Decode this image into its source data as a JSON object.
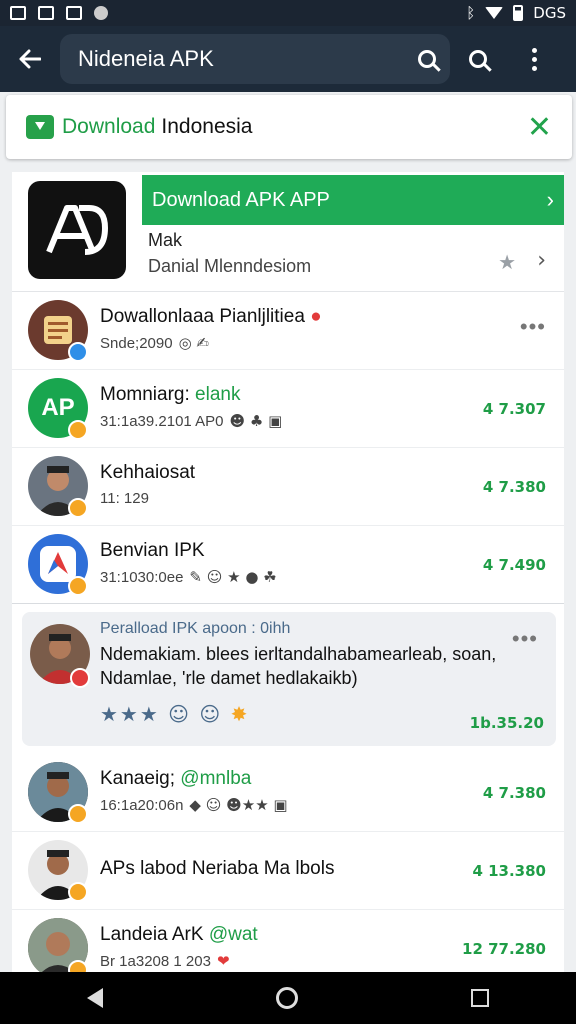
{
  "status": {
    "time": "DGS"
  },
  "appbar": {
    "search_query": "Nideneia APK"
  },
  "banner": {
    "title_green": "Download",
    "title_dark": "Indonesia"
  },
  "featured": {
    "logo_text": "A",
    "button_label": "Download APK APP",
    "line1": "Mak",
    "line2": "Danial Mlenndesiom"
  },
  "list": [
    {
      "title": "Dowallonlaaa Pianljlitiea",
      "meta": "Snde;2090",
      "score": "",
      "avatar_color": "#6b3a2e",
      "badge": "blue"
    },
    {
      "title": "Momniarg:",
      "title_accent": "elank",
      "meta": "31:1a39.2101 AP0",
      "score": "4 7.307",
      "avatar_color": "#19a64f",
      "avatar_text": "AP",
      "badge": "orange"
    },
    {
      "title": "Kehhaiosat",
      "meta": "11: 129",
      "score": "4 7.380",
      "avatar_color": "#6a7480",
      "badge": "orange"
    },
    {
      "title": "Benvian IPK",
      "meta": "31:1030:0ee",
      "score": "4 7.490",
      "avatar_color": "#2f6fd8",
      "badge": "orange"
    }
  ],
  "highlight": {
    "head": "Peralload IPK apoon : 0ihh",
    "text1": "Ndemakiam. blees ierltandalhabamearleab, soan,",
    "text2": "Ndamlae, 'rle damet hedlakaikb)",
    "reactions": "★★★ ☺ ☺",
    "score": "1b.35.20"
  },
  "list2": [
    {
      "title": "Kanaeig;",
      "title_accent": "@mnlba",
      "meta": "16:1a20:06n",
      "score": "4 7.380",
      "avatar_color": "#3a2a22",
      "badge": "orange"
    },
    {
      "title": "APs labod Neriaba Ma lbols",
      "meta": "",
      "score": "4 13.380",
      "avatar_color": "#3b2a22",
      "badge": "orange"
    },
    {
      "title": "Landeia ArK",
      "title_accent": "@wat",
      "meta": "Br 1a3208 1 203",
      "score": "12 77.280",
      "avatar_color": "#5a4a40",
      "badge": "orange"
    }
  ],
  "colors": {
    "brand_green": "#1fab57",
    "appbar": "#1d2a39",
    "accent_text": "#1f9d47"
  }
}
